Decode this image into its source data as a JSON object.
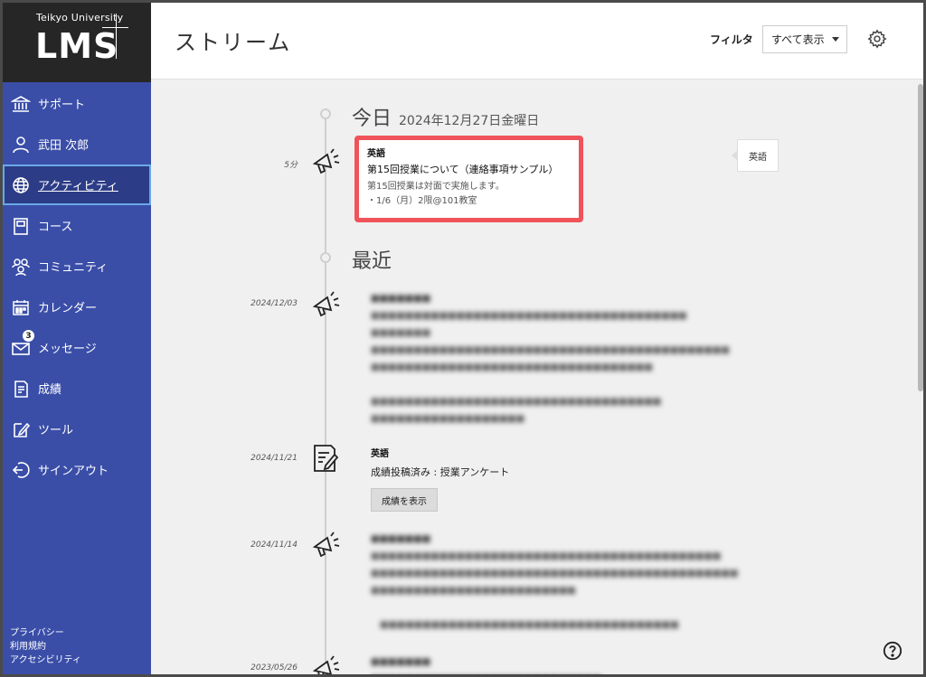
{
  "logo": {
    "university": "Teikyo University",
    "name": "LMS"
  },
  "sidebar": {
    "items": [
      {
        "label": "サポート",
        "icon": "bank-icon"
      },
      {
        "label": "武田 次郎",
        "icon": "user-icon"
      },
      {
        "label": "アクティビティ",
        "icon": "globe-icon",
        "active": true
      },
      {
        "label": "コース",
        "icon": "book-icon"
      },
      {
        "label": "コミュニティ",
        "icon": "people-icon"
      },
      {
        "label": "カレンダー",
        "icon": "calendar-icon"
      },
      {
        "label": "メッセージ",
        "icon": "envelope-icon",
        "badge": "3"
      },
      {
        "label": "成績",
        "icon": "grades-icon"
      },
      {
        "label": "ツール",
        "icon": "edit-icon"
      },
      {
        "label": "サインアウト",
        "icon": "signout-icon"
      }
    ],
    "footer": [
      "プライバシー",
      "利用規約",
      "アクセシビリティ"
    ]
  },
  "header": {
    "title": "ストリーム",
    "filter_label": "フィルタ",
    "filter_value": "すべて表示"
  },
  "stream": {
    "today": {
      "title": "今日",
      "date": "2024年12月27日金曜日"
    },
    "recent": {
      "title": "最近"
    },
    "highlight": {
      "time": "5分",
      "course": "英語",
      "title": "第15回授業について（連絡事項サンプル）",
      "body1": "第15回授業は対面で実施します。",
      "body2": "・1/6（月）2限@101教室",
      "tag": "英語"
    },
    "items": [
      {
        "time": "2024/12/03"
      },
      {
        "time": "2024/11/21",
        "course": "英語",
        "text": "成績投稿済み : 授業アンケート",
        "button": "成績を表示"
      },
      {
        "time": "2024/11/14"
      },
      {
        "time": "2023/05/26"
      }
    ]
  },
  "colors": {
    "sidebar": "#3a4ea8",
    "highlight_border": "#f0535a",
    "logo_bg": "#262626"
  }
}
